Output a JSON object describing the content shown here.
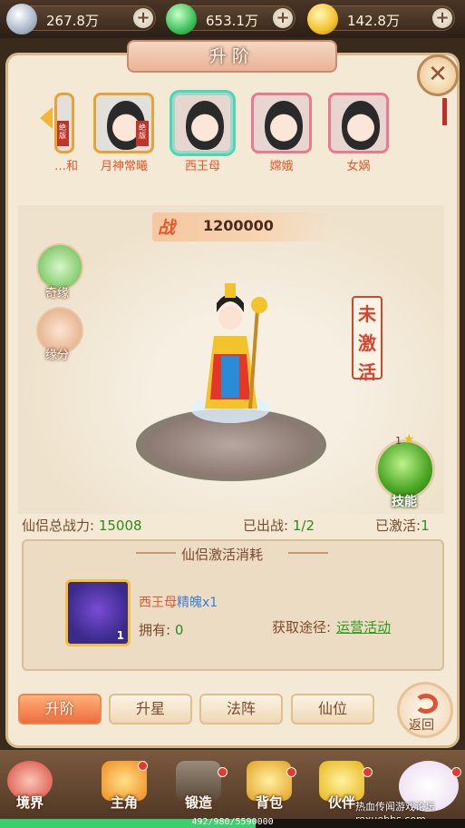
{
  "currency": [
    {
      "icon": "silver-ingot-icon",
      "value": "267.8万"
    },
    {
      "icon": "jade-icon",
      "value": "653.1万"
    },
    {
      "icon": "gold-ingot-icon",
      "value": "142.8万"
    }
  ],
  "plus_label": "+",
  "title": "升阶",
  "roster": [
    {
      "name": "…和",
      "color": "#e9562a",
      "badge": "绝版"
    },
    {
      "name": "月神常曦",
      "color": "#e9562a",
      "badge": "绝版"
    },
    {
      "name": "西王母",
      "color": "#e9562a",
      "selected": true
    },
    {
      "name": "嫦娥",
      "color": "#e9562a"
    },
    {
      "name": "女娲",
      "color": "#e9562a"
    }
  ],
  "power": {
    "label": "战",
    "value": "1200000"
  },
  "side_buttons": {
    "qiyuan": "奇缘",
    "yuanfen": "缘分"
  },
  "status_inactive": [
    "未",
    "激",
    "活"
  ],
  "skill": {
    "label": "技能",
    "level": "1"
  },
  "stats": {
    "total_power_label": "仙侣总战力:",
    "total_power": "15008",
    "deployed_label": "已出战:",
    "deployed": "1/2",
    "activated_label": "已激活:",
    "activated": "1"
  },
  "cost": {
    "title": "仙侣激活消耗",
    "item_qty": "1",
    "item_name_prefix": "西王母",
    "item_name_suffix": "精魄x1",
    "owned_label": "拥有:",
    "owned": "0",
    "source_label": "获取途径:",
    "source_link": "运营活动"
  },
  "tabs": [
    "升阶",
    "升星",
    "法阵",
    "仙位"
  ],
  "back_label": "返回",
  "nav": [
    "境界",
    "主角",
    "锻造",
    "背包",
    "伙伴"
  ],
  "exp_text": "492/980/5590000",
  "exp_fraction": 0.55,
  "watermark": "热血传闻游戏论坛 rexuebbs.com"
}
